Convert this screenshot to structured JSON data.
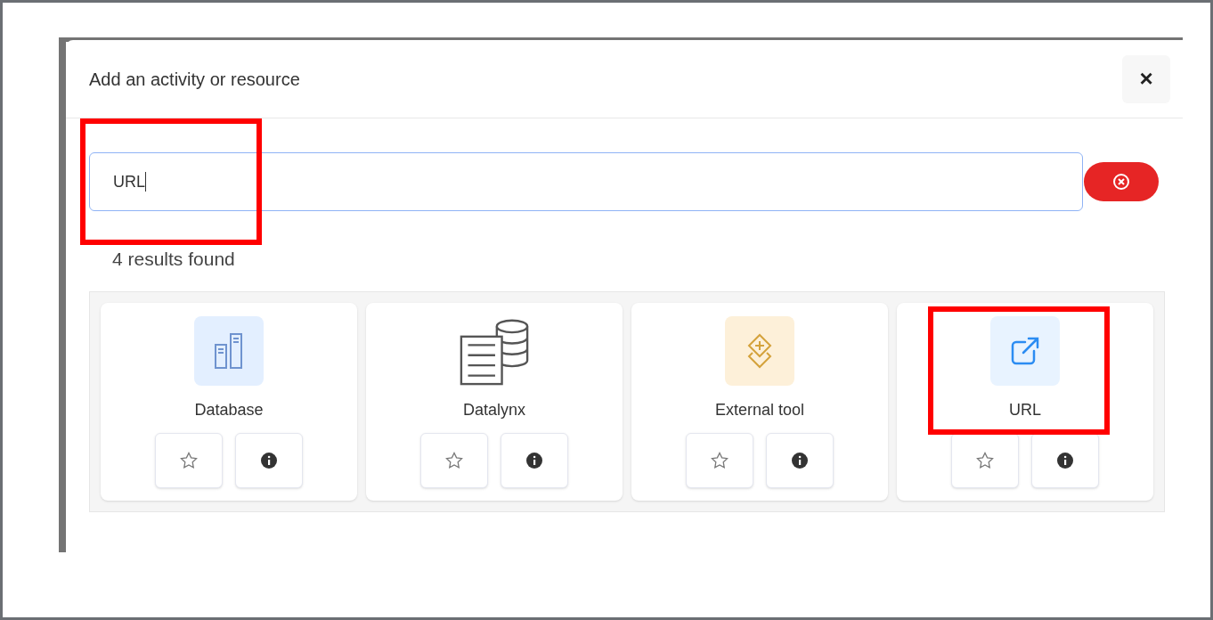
{
  "dialog": {
    "title": "Add an activity or resource",
    "close": "×"
  },
  "search": {
    "value": "URL"
  },
  "results_count": "4 results found",
  "cards": [
    {
      "label": "Database",
      "kind": "database",
      "starred": false
    },
    {
      "label": "Datalynx",
      "kind": "datalynx",
      "starred": false
    },
    {
      "label": "External tool",
      "kind": "external-tool",
      "starred": false
    },
    {
      "label": "URL",
      "kind": "url",
      "starred": false
    }
  ]
}
